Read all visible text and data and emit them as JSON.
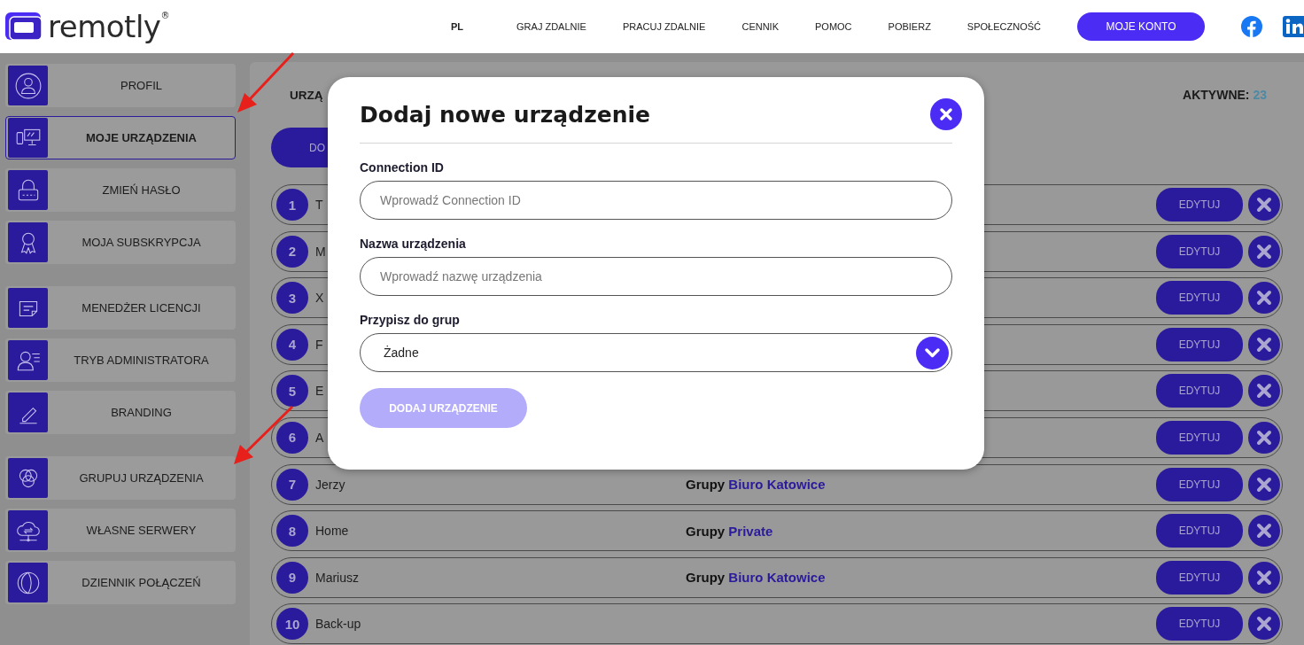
{
  "header": {
    "logo": {
      "name": "remotly",
      "mark": "®"
    },
    "nav": [
      {
        "label": "PL",
        "selected": true
      },
      {
        "label": "GRAJ ZDALNIE",
        "selected": false
      },
      {
        "label": "PRACUJ ZDALNIE",
        "selected": false
      },
      {
        "label": "CENNIK",
        "selected": false
      },
      {
        "label": "POMOC",
        "selected": false
      },
      {
        "label": "POBIERZ",
        "selected": false
      },
      {
        "label": "SPOŁECZNOŚĆ",
        "selected": false
      }
    ],
    "account_button": "MOJE KONTO"
  },
  "sidebar": {
    "sections": [
      {
        "items": [
          {
            "label": "PROFIL",
            "selected": false
          },
          {
            "label": "MOJE URZĄDZENIA",
            "selected": true
          },
          {
            "label": "ZMIEŃ HASŁO",
            "selected": false
          },
          {
            "label": "MOJA SUBSKRYPCJA",
            "selected": false
          }
        ]
      },
      {
        "items": [
          {
            "label": "MENEDŻER LICENCJI",
            "selected": false
          },
          {
            "label": "TRYB ADMINISTRATORA",
            "selected": false
          },
          {
            "label": "BRANDING",
            "selected": false
          }
        ]
      },
      {
        "items": [
          {
            "label": "GRUPUJ URZĄDZENIA",
            "selected": false
          },
          {
            "label": "WŁASNE SERWERY",
            "selected": false
          },
          {
            "label": "DZIENNIK POŁĄCZEŃ",
            "selected": false
          }
        ]
      }
    ]
  },
  "devices": {
    "heading": "URZĄ",
    "active_label": "AKTYWNE:",
    "active_count": "23",
    "add_button": "DO",
    "rows": [
      {
        "number": "1",
        "name": "T",
        "edit": "EDYTUJ"
      },
      {
        "number": "2",
        "name": "M",
        "edit": "EDYTUJ"
      },
      {
        "number": "3",
        "name": "X",
        "edit": "EDYTUJ"
      },
      {
        "number": "4",
        "name": "F",
        "edit": "EDYTUJ"
      },
      {
        "number": "5",
        "name": "E",
        "edit": "EDYTUJ"
      },
      {
        "number": "6",
        "name": "A",
        "edit": "EDYTUJ"
      },
      {
        "number": "7",
        "name": "Jerzy",
        "group_label": "Grupy",
        "group": "Biuro Katowice",
        "edit": "EDYTUJ"
      },
      {
        "number": "8",
        "name": "Home",
        "group_label": "Grupy",
        "group": "Private",
        "edit": "EDYTUJ"
      },
      {
        "number": "9",
        "name": "Mariusz",
        "group_label": "Grupy",
        "group": "Biuro Katowice",
        "edit": "EDYTUJ"
      },
      {
        "number": "10",
        "name": "Back-up",
        "edit": "EDYTUJ"
      }
    ]
  },
  "modal": {
    "title": "Dodaj nowe urządzenie",
    "fields": [
      {
        "kind": "text",
        "label": "Connection ID",
        "placeholder": "Wprowadź Connection ID"
      },
      {
        "kind": "text",
        "label": "Nazwa urządzenia",
        "placeholder": "Wprowadź nazwę urządzenia"
      },
      {
        "kind": "select",
        "label": "Przypisz do grup",
        "value": "Żadne"
      }
    ],
    "submit": {
      "label": "DODAJ URZĄDZENIE",
      "disabled": true
    }
  },
  "annotations": [
    {
      "kind": "arrow"
    },
    {
      "kind": "arrow"
    }
  ]
}
